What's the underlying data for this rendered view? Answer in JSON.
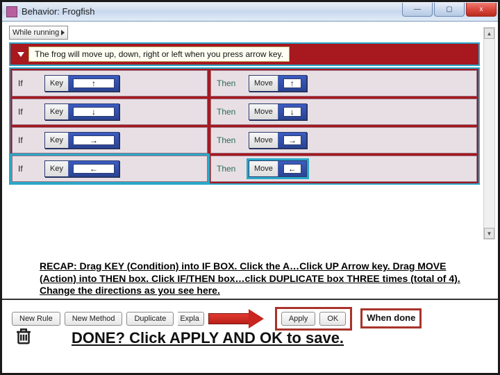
{
  "window": {
    "title": "Behavior: Frogfish",
    "btn_min": "—",
    "btn_max": "▢",
    "btn_close": "x"
  },
  "while": {
    "label": "While running"
  },
  "description": "The frog will move up, down, right or left when you press arrow key.",
  "rules": [
    {
      "if_kw": "If",
      "key_label": "Key",
      "key_arrow": "↑",
      "then_kw": "Then",
      "move_label": "Move",
      "move_arrow": "↑"
    },
    {
      "if_kw": "If",
      "key_label": "Key",
      "key_arrow": "↓",
      "then_kw": "Then",
      "move_label": "Move",
      "move_arrow": "↓"
    },
    {
      "if_kw": "If",
      "key_label": "Key",
      "key_arrow": "→",
      "then_kw": "Then",
      "move_label": "Move",
      "move_arrow": "→"
    },
    {
      "if_kw": "If",
      "key_label": "Key",
      "key_arrow": "←",
      "then_kw": "Then",
      "move_label": "Move",
      "move_arrow": "←"
    }
  ],
  "recap": "RECAP:  Drag KEY (Condition) into IF BOX.  Click the A…Click UP Arrow key.  Drag MOVE  (Action) into THEN box.  Click IF/THEN box…click DUPLICATE box THREE times (total of 4).  Change the directions as you see here.",
  "buttons": {
    "new_rule": "New Rule",
    "new_method": "New Method",
    "duplicate": "Duplicate",
    "explain_stub": "Expla",
    "apply": "Apply",
    "ok": "OK"
  },
  "when_done": "When done",
  "done_line": "DONE?  Click APPLY AND OK to save.",
  "scroll": {
    "up": "▲",
    "down": "▼"
  }
}
